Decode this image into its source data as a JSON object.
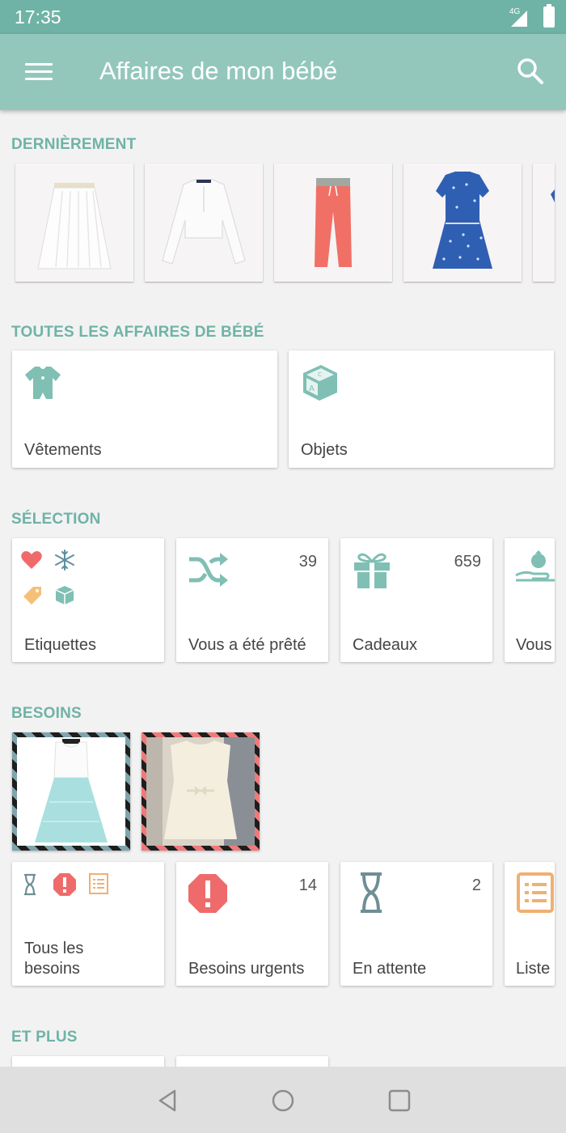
{
  "status": {
    "time": "17:35",
    "network": "4G"
  },
  "app_bar": {
    "title": "Affaires de mon bébé"
  },
  "sections": {
    "recent": "DERNIÈREMENT",
    "all": "TOUTES LES AFFAIRES DE BÉBÉ",
    "selection": "SÉLECTION",
    "needs": "BESOINS",
    "more": "ET PLUS"
  },
  "all_items": [
    {
      "label": "Vêtements",
      "icon": "onesie-icon"
    },
    {
      "label": "Objets",
      "icon": "toy-block-icon"
    }
  ],
  "selection": [
    {
      "label": "Etiquettes",
      "count": ""
    },
    {
      "label": "Vous a été prêté",
      "count": "39"
    },
    {
      "label": "Cadeaux",
      "count": "659"
    },
    {
      "label": "Vous",
      "count": ""
    }
  ],
  "needs": [
    {
      "label_line1": "Tous les",
      "label_line2": "besoins",
      "count": ""
    },
    {
      "label": "Besoins urgents",
      "count": "14"
    },
    {
      "label": "En attente",
      "count": "2"
    },
    {
      "label": "Liste",
      "count": ""
    }
  ],
  "colors": {
    "status_bar": "#6fb3a6",
    "app_bar": "#93c7bc",
    "accent": "#6fb3a6",
    "urgent": "#ef6b6b",
    "list_icon": "#f0b070",
    "hourglass": "#6f8e96"
  }
}
